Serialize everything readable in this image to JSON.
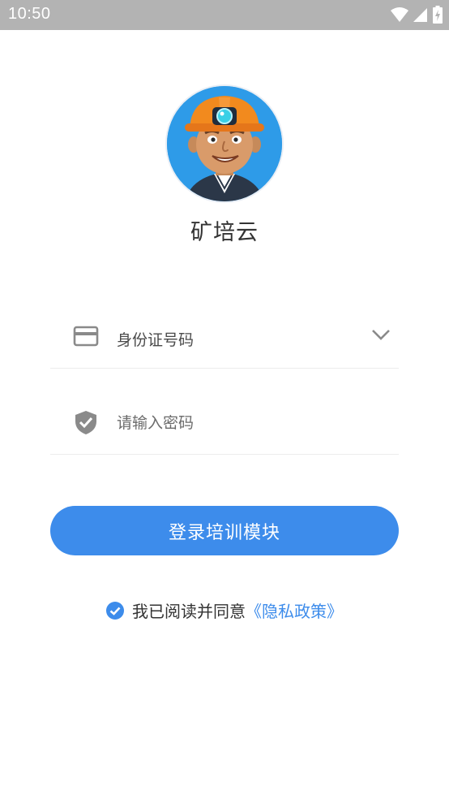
{
  "status_bar": {
    "time": "10:50"
  },
  "app": {
    "name": "矿培云"
  },
  "login_form": {
    "id_field": {
      "label": "身份证号码"
    },
    "password_field": {
      "placeholder": "请输入密码"
    },
    "submit_label": "登录培训模块"
  },
  "agreement": {
    "checked": true,
    "text": "我已阅读并同意",
    "policy_link": "《隐私政策》"
  },
  "colors": {
    "accent": "#3d8ceb",
    "status_bar": "#b3b3b3",
    "icon_gray": "#8a8a8a"
  },
  "icons": {
    "id_field": "id-card-icon",
    "password_field": "shield-check-icon",
    "dropdown": "chevron-down-icon",
    "agreement": "checkmark-circle-icon"
  }
}
